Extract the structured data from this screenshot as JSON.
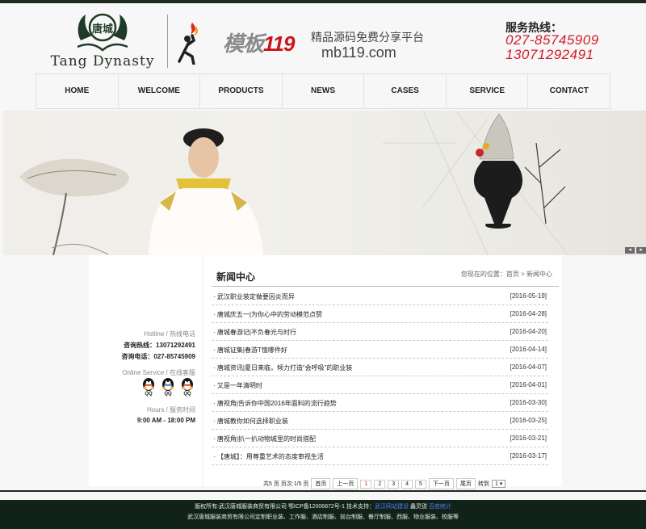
{
  "header": {
    "brand_name": "Tang Dynasty",
    "brand_seal": "唐城",
    "mb_logo_cn": "模板",
    "mb_logo_num": "119",
    "mb_slogan": "精品源码免费分享平台",
    "mb_domain": "mb119.com",
    "hotline_title": "服务热线：",
    "hotline_numbers": [
      "027-85745909",
      "13071292491"
    ]
  },
  "nav": [
    "HOME",
    "WELCOME",
    "PRODUCTS",
    "NEWS",
    "CASES",
    "SERVICE",
    "CONTACT"
  ],
  "banner": {
    "prev": "◂",
    "next": "▸"
  },
  "sidebar": {
    "hotline_label": "Hotline / 热线电话",
    "consult_hotline": "咨询热线：13071292491",
    "consult_phone": "咨询电话：027-85745909",
    "online_label": "Online Service / 在线客服",
    "qq_labels": [
      "QQ",
      "QQ",
      "QQ"
    ],
    "hours_label": "Hours / 服务时间",
    "hours": "9:00 AM - 18:00 PM"
  },
  "main": {
    "title": "新闻中心",
    "breadcrumb_prefix": "您现在的位置：",
    "breadcrumb_home": "首页",
    "breadcrumb_sep": ">",
    "breadcrumb_current": "新闻中心",
    "news": [
      {
        "title": "武汉职业装定做要因炎而异",
        "date": "[2016-05-19]"
      },
      {
        "title": "唐城庆五一|为你心中的劳动模范点赞",
        "date": "[2016-04-28]"
      },
      {
        "title": "唐城春游记|不负春光与时行",
        "date": "[2016-04-20]"
      },
      {
        "title": "唐城证集|春游T恤哪件好",
        "date": "[2016-04-14]"
      },
      {
        "title": "唐城资讯|夏日来临，倾力打造“会呼吸”的职业装",
        "date": "[2016-04-07]"
      },
      {
        "title": "又是一年清明时",
        "date": "[2016-04-01]"
      },
      {
        "title": "唐视角|告诉你中国2016年面料的流行趋势",
        "date": "[2016-03-30]"
      },
      {
        "title": "唐城教你如何选择职业装",
        "date": "[2016-03-25]"
      },
      {
        "title": "唐视角|扒一扒动物城里的时尚搭配",
        "date": "[2016-03-21]"
      },
      {
        "title": "【唐城】：用尊重艺术的态度审视生活",
        "date": "[2016-03-17]"
      }
    ],
    "pager": {
      "summary": "共5 页 页次:1/5 页",
      "first": "首页",
      "prev": "上一页",
      "pages": [
        "1",
        "2",
        "3",
        "4",
        "5"
      ],
      "next": "下一页",
      "last": "尾页",
      "goto": "转到",
      "selected": "1"
    }
  },
  "footer": {
    "line1": "版权所有:武汉唐城服装商贸有限公司 鄂ICP备12006872号-1 技术支持：",
    "line1_link": "武汉网站建设",
    "line1_extra": "鑫灵锐",
    "line1_extra2": "百度统计",
    "line2": "武汉唐城服装商贸有限公司定制职业装、工作服、酒店制服、前台制服、餐厅制服、西服、物业服装、校服等"
  },
  "colors": {
    "accent_red": "#d21d2a",
    "dark_green": "#112318"
  }
}
